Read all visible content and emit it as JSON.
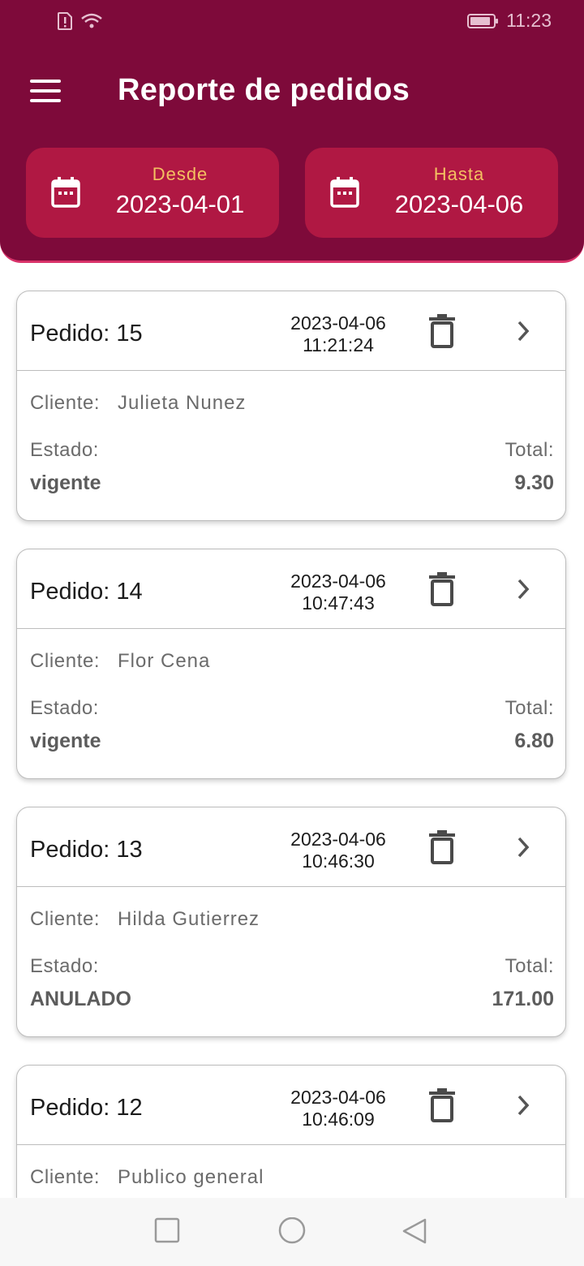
{
  "status_bar": {
    "time": "11:23"
  },
  "app_bar": {
    "title": "Reporte de pedidos"
  },
  "date_filter": {
    "from": {
      "label": "Desde",
      "value": "2023-04-01"
    },
    "to": {
      "label": "Hasta",
      "value": "2023-04-06"
    }
  },
  "labels": {
    "order_prefix": "Pedido:",
    "client": "Cliente:",
    "status": "Estado:",
    "total": "Total:"
  },
  "orders": [
    {
      "number": "Pedido: 15",
      "date": "2023-04-06",
      "time": "11:21:24",
      "client": "Julieta Nunez",
      "status": "vigente",
      "total": "9.30"
    },
    {
      "number": "Pedido: 14",
      "date": "2023-04-06",
      "time": "10:47:43",
      "client": "Flor Cena",
      "status": "vigente",
      "total": "6.80"
    },
    {
      "number": "Pedido: 13",
      "date": "2023-04-06",
      "time": "10:46:30",
      "client": "Hilda Gutierrez",
      "status": "ANULADO",
      "total": "171.00"
    },
    {
      "number": "Pedido: 12",
      "date": "2023-04-06",
      "time": "10:46:09",
      "client": "Publico general",
      "status": "",
      "total": ""
    }
  ],
  "icons": {
    "menu": "menu-icon",
    "calendar": "calendar-icon",
    "trash": "trash-icon",
    "chevron": "chevron-right-icon",
    "nav_recents": "square-icon",
    "nav_home": "circle-icon",
    "nav_back": "triangle-back-icon"
  },
  "colors": {
    "primary": "#7e0a3a",
    "accent": "#b01843",
    "label_accent": "#f3c061"
  }
}
